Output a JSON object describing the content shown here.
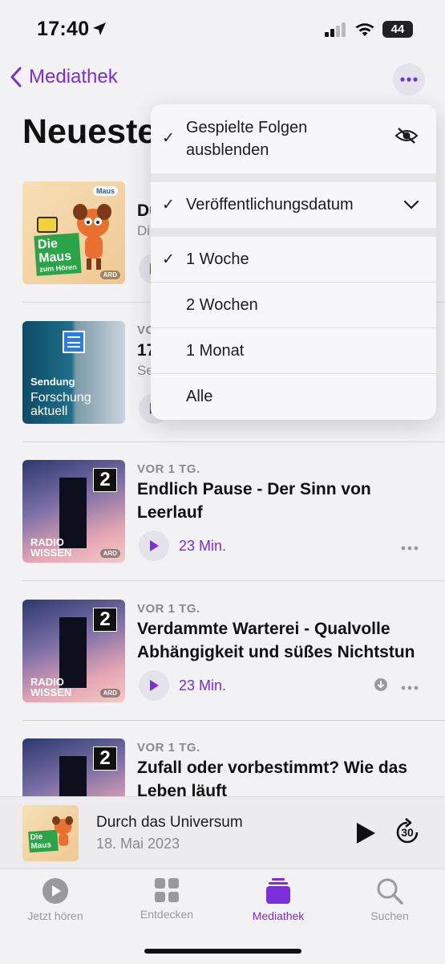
{
  "status": {
    "time": "17:40",
    "battery": "44"
  },
  "nav": {
    "back_label": "Mediathek"
  },
  "page": {
    "title": "Neueste"
  },
  "menu": {
    "hide_played": "Gespielte Folgen ausblenden",
    "sort": "Veröffentlichungsdatum",
    "ranges": [
      "1 Woche",
      "2 Wochen",
      "1 Monat",
      "Alle"
    ],
    "checked_range": "1 Woche"
  },
  "episodes": [
    {
      "date": "",
      "title": "Du",
      "subtitle": "Di",
      "duration": ""
    },
    {
      "date": "VOR",
      "title": "17",
      "subtitle": "Se",
      "duration": ""
    },
    {
      "date": "VOR 1 TG.",
      "title": "Endlich Pause - Der Sinn von Leerlauf",
      "duration": "23 Min."
    },
    {
      "date": "VOR 1 TG.",
      "title": "Verdammte Warterei - Qualvolle Abhängigkeit und süßes Nichtstun",
      "duration": "23 Min."
    },
    {
      "date": "VOR 1 TG.",
      "title": "Zufall oder vorbestimmt? Wie das Leben läuft",
      "duration": ""
    }
  ],
  "art": {
    "maus": {
      "line1": "Die",
      "line2": "Maus",
      "line3": "zum Hören",
      "badge": "Maus",
      "ard": "ARD"
    },
    "forschung": {
      "line1": "Sendung",
      "line2": "Forschung",
      "line3": "aktuell"
    },
    "radio": {
      "line1": "RADIO",
      "line2": "WISSEN",
      "br": "2",
      "ard": "ARD"
    }
  },
  "mini_player": {
    "title": "Durch das Universum",
    "date": "18. Mai 2023",
    "skip": "30"
  },
  "tabs": [
    {
      "label": "Jetzt hören"
    },
    {
      "label": "Entdecken"
    },
    {
      "label": "Mediathek"
    },
    {
      "label": "Suchen"
    }
  ],
  "colors": {
    "accent": "#7a2fd9",
    "background": "#f2f2f4"
  }
}
